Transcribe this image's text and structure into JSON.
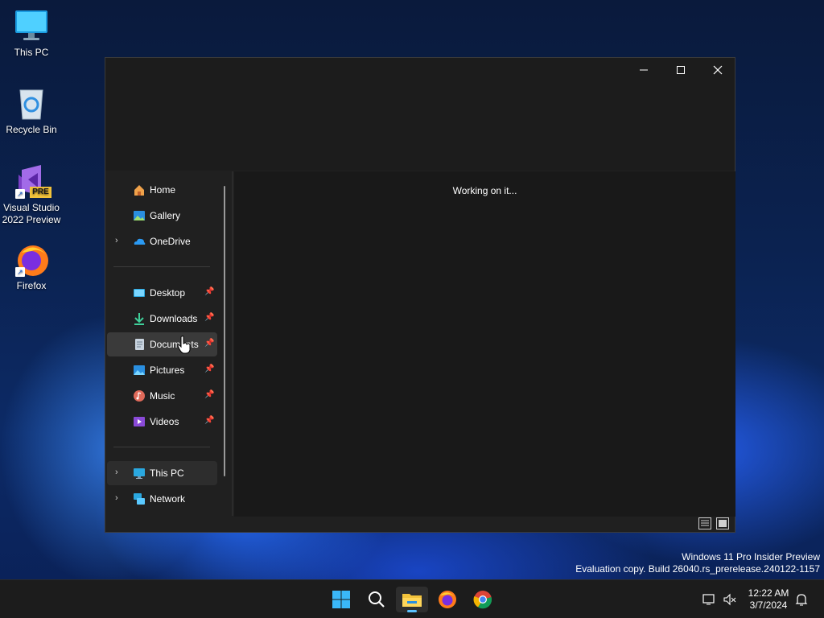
{
  "desktop": {
    "icons": [
      {
        "label": "This PC",
        "icon": "monitor-icon"
      },
      {
        "label": "Recycle Bin",
        "icon": "recycle-bin-icon"
      },
      {
        "label": "Visual Studio 2022 Preview",
        "badge": "PRE",
        "icon": "visual-studio-icon"
      },
      {
        "label": "Firefox",
        "icon": "firefox-icon"
      }
    ]
  },
  "window": {
    "controls": {
      "minimize": "—",
      "maximize": "☐",
      "close": "✕"
    },
    "content_status": "Working on it...",
    "nav": {
      "items": [
        {
          "label": "Home",
          "icon": "home-icon"
        },
        {
          "label": "Gallery",
          "icon": "gallery-icon"
        },
        {
          "label": "OneDrive",
          "icon": "onedrive-icon",
          "expandable": true
        },
        {
          "label": "Desktop",
          "icon": "desktop-folder-icon",
          "pinned": true
        },
        {
          "label": "Downloads",
          "icon": "downloads-icon",
          "pinned": true
        },
        {
          "label": "Documents",
          "icon": "documents-icon",
          "pinned": true,
          "hovered": true
        },
        {
          "label": "Pictures",
          "icon": "pictures-icon",
          "pinned": true
        },
        {
          "label": "Music",
          "icon": "music-icon",
          "pinned": true
        },
        {
          "label": "Videos",
          "icon": "videos-icon",
          "pinned": true
        },
        {
          "label": "This PC",
          "icon": "this-pc-icon",
          "expandable": true,
          "selected": true
        },
        {
          "label": "Network",
          "icon": "network-icon",
          "expandable": true
        }
      ]
    }
  },
  "watermark": {
    "line1": "Windows 11 Pro Insider Preview",
    "line2": "Evaluation copy. Build 26040.rs_prerelease.240122-1157"
  },
  "taskbar": {
    "apps": [
      {
        "name": "start",
        "icon": "windows-start-icon"
      },
      {
        "name": "search",
        "icon": "search-icon"
      },
      {
        "name": "file-explorer",
        "icon": "file-explorer-icon",
        "active": true
      },
      {
        "name": "firefox",
        "icon": "firefox-icon"
      },
      {
        "name": "chrome",
        "icon": "chrome-icon"
      }
    ],
    "clock": {
      "time": "12:22 AM",
      "date": "3/7/2024"
    }
  },
  "colors": {
    "accent": "#5cc2ff",
    "window_bg": "#202020",
    "taskbar_bg": "#1c1c1c"
  }
}
